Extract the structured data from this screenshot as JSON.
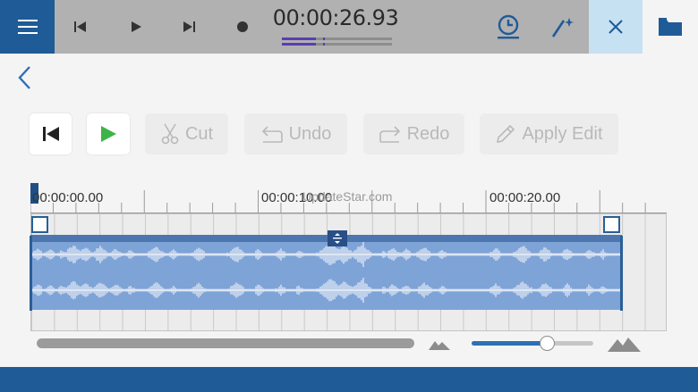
{
  "transport": {
    "timecode": "00:00:26.93",
    "level_meter": {
      "fill": 0.31
    }
  },
  "toolbar": {
    "cut_label": "Cut",
    "undo_label": "Undo",
    "redo_label": "Redo",
    "apply_label": "Apply Edit"
  },
  "timeline": {
    "labels": [
      "00:00:00.00",
      "00:00:10.00",
      "00:00:20.00"
    ],
    "watermark": "UpdateStar.com"
  },
  "zoom": {
    "level": 0.62
  },
  "colors": {
    "brand": "#1f5b97",
    "play_green": "#3cb44a",
    "selection": "#7ea3d6",
    "level_meter": "#5a3db3"
  },
  "icons": [
    "menu-icon",
    "skip-back-icon",
    "play-icon",
    "skip-forward-icon",
    "record-icon",
    "timer-icon",
    "magic-wand-icon",
    "close-icon",
    "folder-icon",
    "back-chevron-icon",
    "scissors-icon",
    "undo-icon",
    "redo-icon",
    "pencil-icon",
    "mountain-icon"
  ]
}
